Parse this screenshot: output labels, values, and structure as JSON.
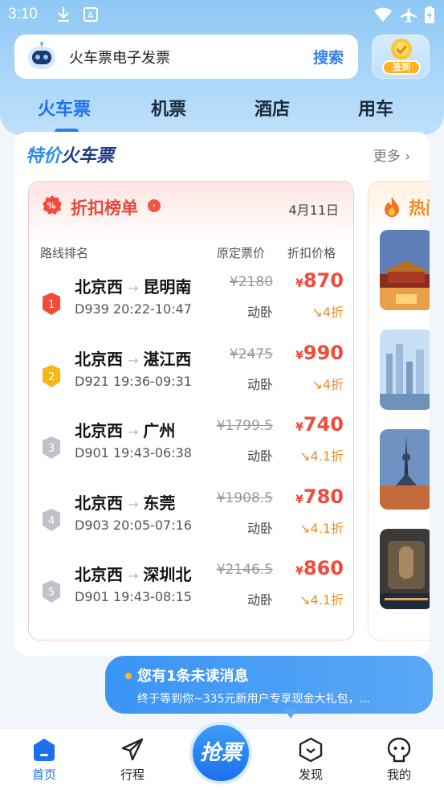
{
  "status_bar": {
    "time": "3:10",
    "icons": [
      "download-icon",
      "a-icon",
      "wifi-icon",
      "airplane-mode-icon",
      "battery-charging-icon"
    ]
  },
  "search": {
    "text": "火车票电子发票",
    "button": "搜索",
    "icon": "robot-icon"
  },
  "checkin": {
    "label": "签到"
  },
  "tabs": [
    {
      "label": "火车票",
      "active": true
    },
    {
      "label": "机票",
      "active": false
    },
    {
      "label": "酒店",
      "active": false
    },
    {
      "label": "用车",
      "active": false
    }
  ],
  "section": {
    "title_prefix": "特价",
    "title_suffix": "火车票",
    "more": "更多"
  },
  "ranking": {
    "title": "折扣榜单",
    "date": "4月11日",
    "columns": {
      "route": "路线排名",
      "original": "原定票价",
      "discount": "折扣价格"
    },
    "currency": "¥",
    "rows": [
      {
        "rank": "1",
        "from": "北京西",
        "to": "昆明南",
        "train": "D939 20:22-10:47",
        "original": "¥2180",
        "seat": "动卧",
        "price": "870",
        "discount": "4折",
        "badge_color": "#f24b3c"
      },
      {
        "rank": "2",
        "from": "北京西",
        "to": "湛江西",
        "train": "D921 19:36-09:31",
        "original": "¥2475",
        "seat": "动卧",
        "price": "990",
        "discount": "4折",
        "badge_color": "#f6b616"
      },
      {
        "rank": "3",
        "from": "北京西",
        "to": "广州",
        "train": "D901 19:43-06:38",
        "original": "¥1799.5",
        "seat": "动卧",
        "price": "740",
        "discount": "4.1折",
        "badge_color": "#bfc3c9"
      },
      {
        "rank": "4",
        "from": "北京西",
        "to": "东莞",
        "train": "D903 20:05-07:16",
        "original": "¥1908.5",
        "seat": "动卧",
        "price": "780",
        "discount": "4.1折",
        "badge_color": "#bfc3c9"
      },
      {
        "rank": "5",
        "from": "北京西",
        "to": "深圳北",
        "train": "D901 19:43-08:15",
        "original": "¥2146.5",
        "seat": "动卧",
        "price": "860",
        "discount": "4.1折",
        "badge_color": "#bfc3c9"
      }
    ]
  },
  "hot": {
    "title": "热门"
  },
  "message": {
    "title": "您有1条未读消息",
    "body": "终于等到你~335元新用户专享现金大礼包，..."
  },
  "bottom_nav": [
    {
      "label": "首页",
      "icon": "home-icon",
      "active": true
    },
    {
      "label": "行程",
      "icon": "paper-plane-icon",
      "active": false
    },
    {
      "label": "发现",
      "icon": "discover-icon",
      "active": false
    },
    {
      "label": "我的",
      "icon": "profile-icon",
      "active": false
    }
  ],
  "grab_button": "抢票",
  "colors": {
    "accent": "#1e6ff0",
    "price_red": "#f24b3c",
    "discount_orange": "#f28a1e"
  }
}
